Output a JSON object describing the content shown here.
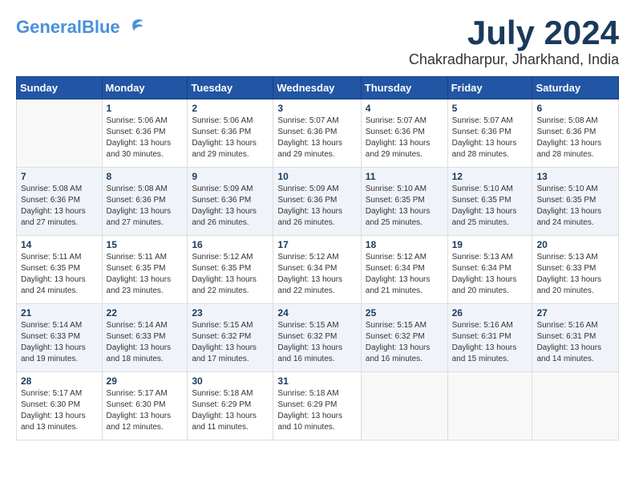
{
  "header": {
    "logo_line1": "General",
    "logo_line2": "Blue",
    "month_year": "July 2024",
    "location": "Chakradharpur, Jharkhand, India"
  },
  "weekdays": [
    "Sunday",
    "Monday",
    "Tuesday",
    "Wednesday",
    "Thursday",
    "Friday",
    "Saturday"
  ],
  "weeks": [
    [
      {
        "day": "",
        "empty": true
      },
      {
        "day": "1",
        "sunrise": "Sunrise: 5:06 AM",
        "sunset": "Sunset: 6:36 PM",
        "daylight": "Daylight: 13 hours and 30 minutes."
      },
      {
        "day": "2",
        "sunrise": "Sunrise: 5:06 AM",
        "sunset": "Sunset: 6:36 PM",
        "daylight": "Daylight: 13 hours and 29 minutes."
      },
      {
        "day": "3",
        "sunrise": "Sunrise: 5:07 AM",
        "sunset": "Sunset: 6:36 PM",
        "daylight": "Daylight: 13 hours and 29 minutes."
      },
      {
        "day": "4",
        "sunrise": "Sunrise: 5:07 AM",
        "sunset": "Sunset: 6:36 PM",
        "daylight": "Daylight: 13 hours and 29 minutes."
      },
      {
        "day": "5",
        "sunrise": "Sunrise: 5:07 AM",
        "sunset": "Sunset: 6:36 PM",
        "daylight": "Daylight: 13 hours and 28 minutes."
      },
      {
        "day": "6",
        "sunrise": "Sunrise: 5:08 AM",
        "sunset": "Sunset: 6:36 PM",
        "daylight": "Daylight: 13 hours and 28 minutes."
      }
    ],
    [
      {
        "day": "7",
        "sunrise": "Sunrise: 5:08 AM",
        "sunset": "Sunset: 6:36 PM",
        "daylight": "Daylight: 13 hours and 27 minutes."
      },
      {
        "day": "8",
        "sunrise": "Sunrise: 5:08 AM",
        "sunset": "Sunset: 6:36 PM",
        "daylight": "Daylight: 13 hours and 27 minutes."
      },
      {
        "day": "9",
        "sunrise": "Sunrise: 5:09 AM",
        "sunset": "Sunset: 6:36 PM",
        "daylight": "Daylight: 13 hours and 26 minutes."
      },
      {
        "day": "10",
        "sunrise": "Sunrise: 5:09 AM",
        "sunset": "Sunset: 6:36 PM",
        "daylight": "Daylight: 13 hours and 26 minutes."
      },
      {
        "day": "11",
        "sunrise": "Sunrise: 5:10 AM",
        "sunset": "Sunset: 6:35 PM",
        "daylight": "Daylight: 13 hours and 25 minutes."
      },
      {
        "day": "12",
        "sunrise": "Sunrise: 5:10 AM",
        "sunset": "Sunset: 6:35 PM",
        "daylight": "Daylight: 13 hours and 25 minutes."
      },
      {
        "day": "13",
        "sunrise": "Sunrise: 5:10 AM",
        "sunset": "Sunset: 6:35 PM",
        "daylight": "Daylight: 13 hours and 24 minutes."
      }
    ],
    [
      {
        "day": "14",
        "sunrise": "Sunrise: 5:11 AM",
        "sunset": "Sunset: 6:35 PM",
        "daylight": "Daylight: 13 hours and 24 minutes."
      },
      {
        "day": "15",
        "sunrise": "Sunrise: 5:11 AM",
        "sunset": "Sunset: 6:35 PM",
        "daylight": "Daylight: 13 hours and 23 minutes."
      },
      {
        "day": "16",
        "sunrise": "Sunrise: 5:12 AM",
        "sunset": "Sunset: 6:35 PM",
        "daylight": "Daylight: 13 hours and 22 minutes."
      },
      {
        "day": "17",
        "sunrise": "Sunrise: 5:12 AM",
        "sunset": "Sunset: 6:34 PM",
        "daylight": "Daylight: 13 hours and 22 minutes."
      },
      {
        "day": "18",
        "sunrise": "Sunrise: 5:12 AM",
        "sunset": "Sunset: 6:34 PM",
        "daylight": "Daylight: 13 hours and 21 minutes."
      },
      {
        "day": "19",
        "sunrise": "Sunrise: 5:13 AM",
        "sunset": "Sunset: 6:34 PM",
        "daylight": "Daylight: 13 hours and 20 minutes."
      },
      {
        "day": "20",
        "sunrise": "Sunrise: 5:13 AM",
        "sunset": "Sunset: 6:33 PM",
        "daylight": "Daylight: 13 hours and 20 minutes."
      }
    ],
    [
      {
        "day": "21",
        "sunrise": "Sunrise: 5:14 AM",
        "sunset": "Sunset: 6:33 PM",
        "daylight": "Daylight: 13 hours and 19 minutes."
      },
      {
        "day": "22",
        "sunrise": "Sunrise: 5:14 AM",
        "sunset": "Sunset: 6:33 PM",
        "daylight": "Daylight: 13 hours and 18 minutes."
      },
      {
        "day": "23",
        "sunrise": "Sunrise: 5:15 AM",
        "sunset": "Sunset: 6:32 PM",
        "daylight": "Daylight: 13 hours and 17 minutes."
      },
      {
        "day": "24",
        "sunrise": "Sunrise: 5:15 AM",
        "sunset": "Sunset: 6:32 PM",
        "daylight": "Daylight: 13 hours and 16 minutes."
      },
      {
        "day": "25",
        "sunrise": "Sunrise: 5:15 AM",
        "sunset": "Sunset: 6:32 PM",
        "daylight": "Daylight: 13 hours and 16 minutes."
      },
      {
        "day": "26",
        "sunrise": "Sunrise: 5:16 AM",
        "sunset": "Sunset: 6:31 PM",
        "daylight": "Daylight: 13 hours and 15 minutes."
      },
      {
        "day": "27",
        "sunrise": "Sunrise: 5:16 AM",
        "sunset": "Sunset: 6:31 PM",
        "daylight": "Daylight: 13 hours and 14 minutes."
      }
    ],
    [
      {
        "day": "28",
        "sunrise": "Sunrise: 5:17 AM",
        "sunset": "Sunset: 6:30 PM",
        "daylight": "Daylight: 13 hours and 13 minutes."
      },
      {
        "day": "29",
        "sunrise": "Sunrise: 5:17 AM",
        "sunset": "Sunset: 6:30 PM",
        "daylight": "Daylight: 13 hours and 12 minutes."
      },
      {
        "day": "30",
        "sunrise": "Sunrise: 5:18 AM",
        "sunset": "Sunset: 6:29 PM",
        "daylight": "Daylight: 13 hours and 11 minutes."
      },
      {
        "day": "31",
        "sunrise": "Sunrise: 5:18 AM",
        "sunset": "Sunset: 6:29 PM",
        "daylight": "Daylight: 13 hours and 10 minutes."
      },
      {
        "day": "",
        "empty": true
      },
      {
        "day": "",
        "empty": true
      },
      {
        "day": "",
        "empty": true
      }
    ]
  ]
}
